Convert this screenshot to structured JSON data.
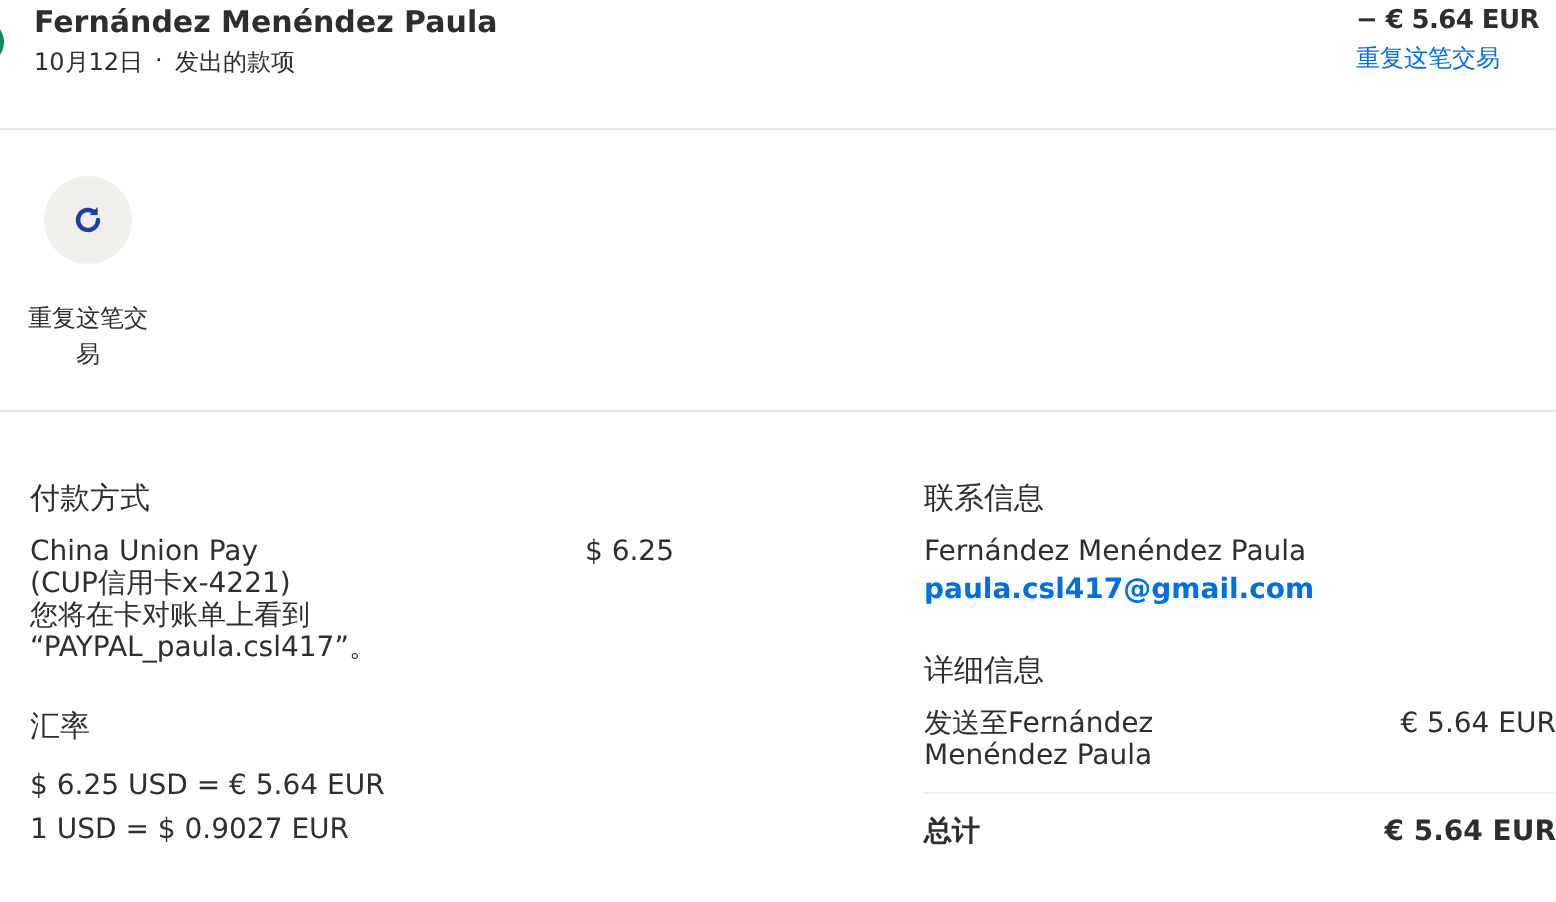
{
  "header": {
    "name": "Fernández Menéndez Paula",
    "date": "10月12日",
    "separator": "·",
    "type": "发出的款项",
    "amount": "− € 5.64 EUR",
    "repeat_link": "重复这笔交易"
  },
  "actions": [
    {
      "label": "重复这笔交易"
    }
  ],
  "payment": {
    "title": "付款方式",
    "method_lines": [
      "China Union Pay",
      "(CUP信用卡x-4221)",
      "您将在卡对账单上看到",
      "“PAYPAL_paula.csl417”。"
    ],
    "amount": "$ 6.25"
  },
  "exchange": {
    "title": "汇率",
    "lines": [
      "$ 6.25 USD = € 5.64 EUR",
      "1 USD = $ 0.9027 EUR"
    ]
  },
  "contact": {
    "title": "联系信息",
    "name": "Fernández Menéndez Paula",
    "email": "paula.csl417@gmail.com"
  },
  "details": {
    "title": "详细信息",
    "rows": [
      {
        "label": "发送至Fernández Menéndez Paula",
        "amount": "€ 5.64 EUR",
        "kind": "item"
      },
      {
        "label": "总计",
        "amount": "€ 5.64 EUR",
        "kind": "total"
      }
    ]
  }
}
